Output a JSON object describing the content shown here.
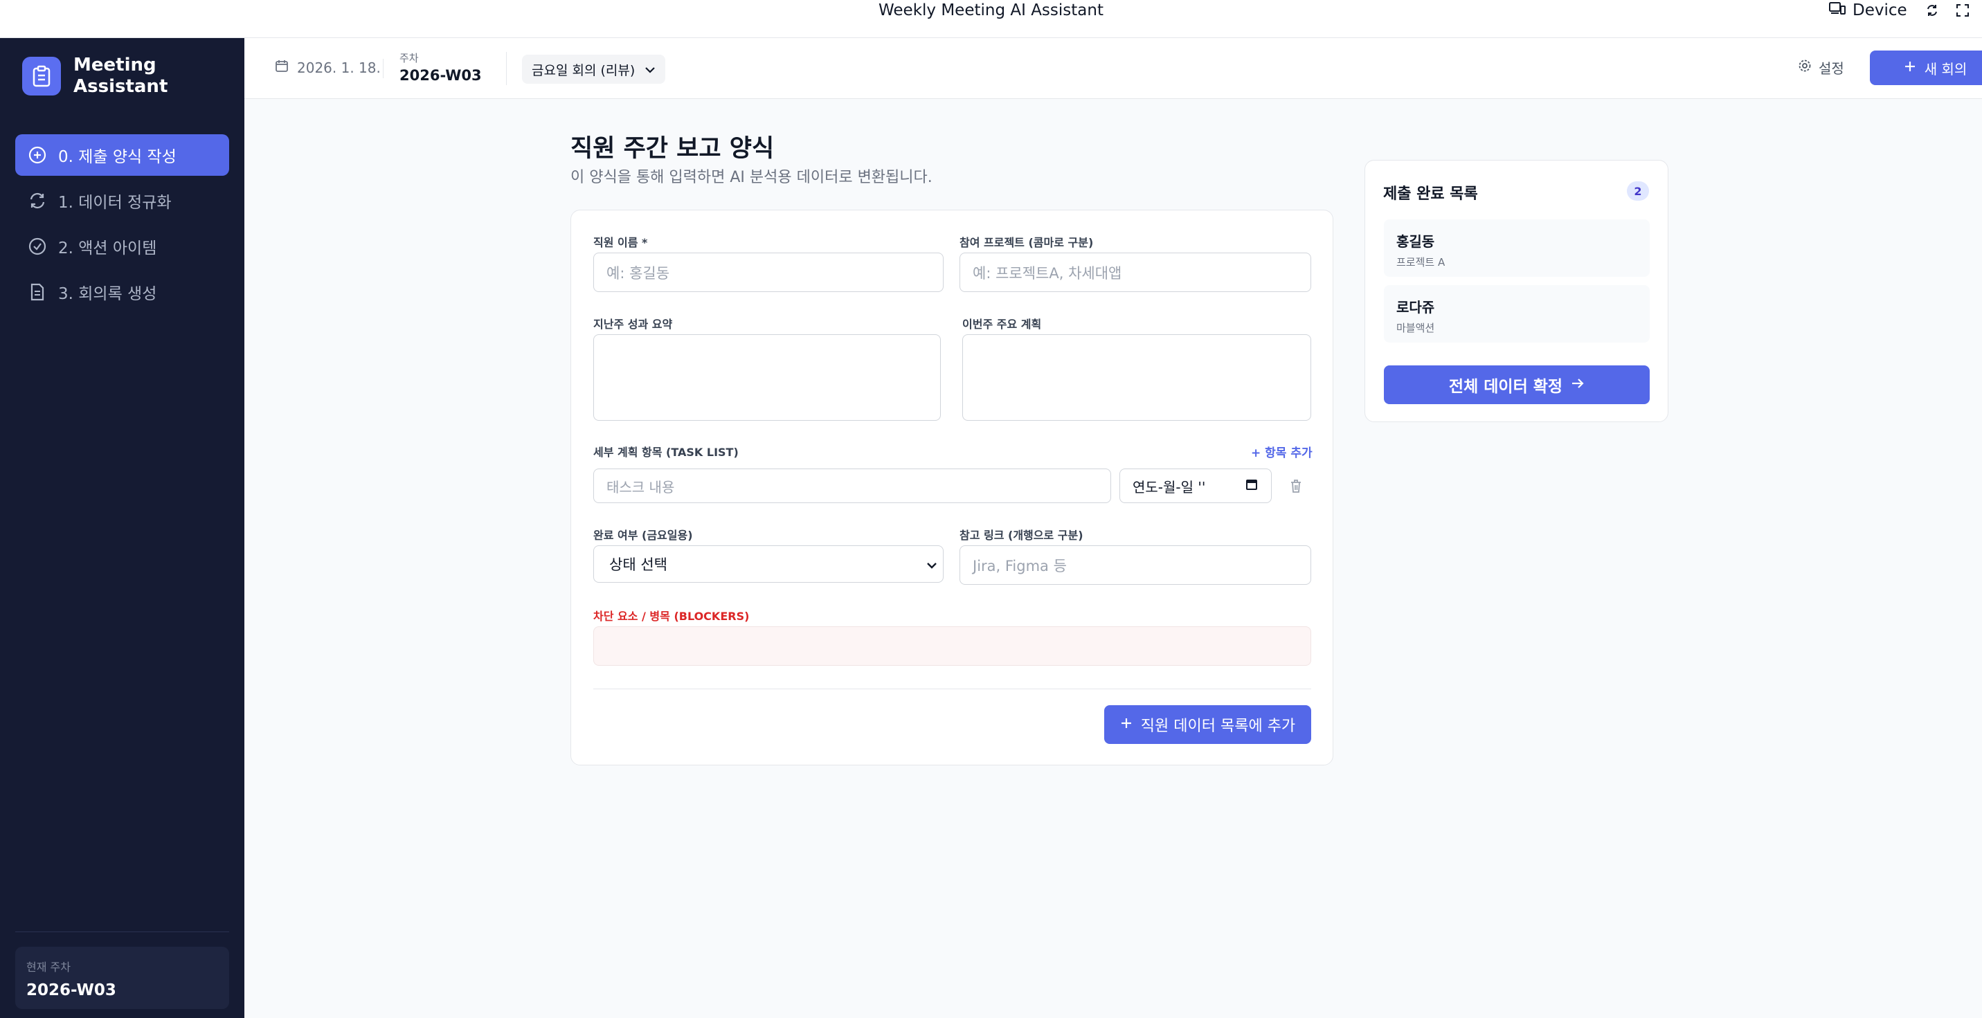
{
  "window": {
    "title": "Weekly Meeting AI Assistant",
    "device_label": "Device"
  },
  "sidebar": {
    "brand": "Meeting Assistant",
    "items": [
      {
        "label": "0. 제출 양식 작성",
        "icon": "plus-circle-icon",
        "active": true
      },
      {
        "label": "1. 데이터 정규화",
        "icon": "refresh-icon",
        "active": false
      },
      {
        "label": "2. 액션 아이템",
        "icon": "check-circle-icon",
        "active": false
      },
      {
        "label": "3. 회의록 생성",
        "icon": "document-icon",
        "active": false
      }
    ],
    "current_week_label": "현재 주차",
    "current_week_value": "2026-W03"
  },
  "header": {
    "date": "2026. 1. 18.",
    "week_label": "주차",
    "week_value": "2026-W03",
    "meeting_select": "금요일 회의 (리뷰)",
    "settings_label": "설정",
    "new_meeting_label": "새 회의"
  },
  "page": {
    "title": "직원 주간 보고 양식",
    "subtitle": "이 양식을 통해 입력하면 AI 분석용 데이터로 변환됩니다."
  },
  "form": {
    "name_label": "직원 이름 *",
    "name_placeholder": "예: 홍길동",
    "project_label": "참여 프로젝트 (콤마로 구분)",
    "project_placeholder": "예: 프로젝트A, 차세대앱",
    "last_week_label": "지난주 성과 요약",
    "this_week_label": "이번주 주요 계획",
    "task_list_label": "세부 계획 항목 (TASK LIST)",
    "add_item_label": "+ 항목 추가",
    "task_placeholder": "태스크 내용",
    "date_placeholder": "연도-월-일 ''",
    "status_label": "완료 여부 (금요일용)",
    "status_value": "상태 선택",
    "links_label": "참고 링크 (개행으로 구분)",
    "links_placeholder": "Jira, Figma 등",
    "blockers_label": "차단 요소 / 병목 (BLOCKERS)",
    "submit_label": "직원 데이터 목록에 추가"
  },
  "submitted": {
    "title": "제출 완료 목록",
    "count": "2",
    "items": [
      {
        "name": "홍길동",
        "project": "프로젝트 A"
      },
      {
        "name": "로다쥬",
        "project": "마블액션"
      }
    ],
    "confirm_label": "전체 데이터 확정"
  },
  "colors": {
    "accent": "#5468e8",
    "sidebar_bg": "#151b33",
    "danger": "#dc2626"
  }
}
